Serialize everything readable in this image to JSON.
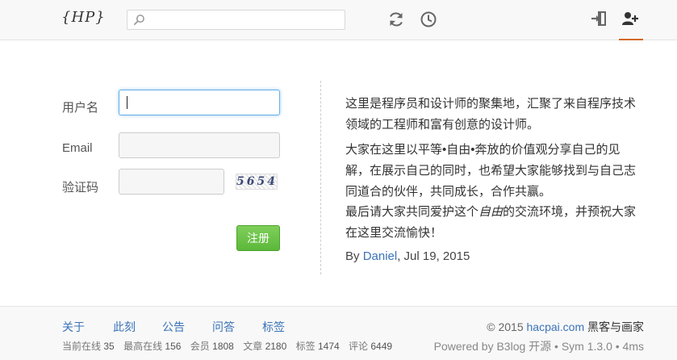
{
  "header": {
    "logo": "{HP}",
    "search_placeholder": ""
  },
  "form": {
    "username_label": "用户名",
    "email_label": "Email",
    "captcha_label": "验证码",
    "username_value": "",
    "email_value": "",
    "captcha_value": "",
    "captcha_code": "5654",
    "submit_label": "注册"
  },
  "intro": {
    "p1": "这里是程序员和设计师的聚集地，汇聚了来自程序技术领域的工程师和富有创意的设计师。",
    "p2": "大家在这里以平等•自由•奔放的价值观分享自己的见解，在展示自己的同时，也希望大家能够找到与自己志同道合的伙伴，共同成长，合作共赢。",
    "p3_before": "最后请大家共同爱护这个",
    "p3_em": "自由",
    "p3_after": "的交流环境，并预祝大家在这里交流愉快！",
    "by": "By ",
    "author": "Daniel",
    "date": ", Jul 19, 2015"
  },
  "footer": {
    "nav": [
      "关于",
      "此刻",
      "公告",
      "问答",
      "标签"
    ],
    "stats": [
      {
        "label": "当前在线",
        "value": "35"
      },
      {
        "label": "最高在线",
        "value": "156"
      },
      {
        "label": "会员",
        "value": "1808"
      },
      {
        "label": "文章",
        "value": "2180"
      },
      {
        "label": "标签",
        "value": "1474"
      },
      {
        "label": "评论",
        "value": "6449"
      }
    ],
    "copyright_prefix": "© 2015 ",
    "site_link": "hacpai.com",
    "brand": " 黑客与画家",
    "powered": "Powered by B3log 开源 • Sym 1.3.0 • 4ms"
  },
  "colors": {
    "link": "#3b73b9",
    "accent": "#d2691e",
    "submit": "#5cb83a"
  },
  "icons": [
    "search-icon",
    "refresh-icon",
    "clock-icon",
    "login-icon",
    "add-user-icon"
  ]
}
